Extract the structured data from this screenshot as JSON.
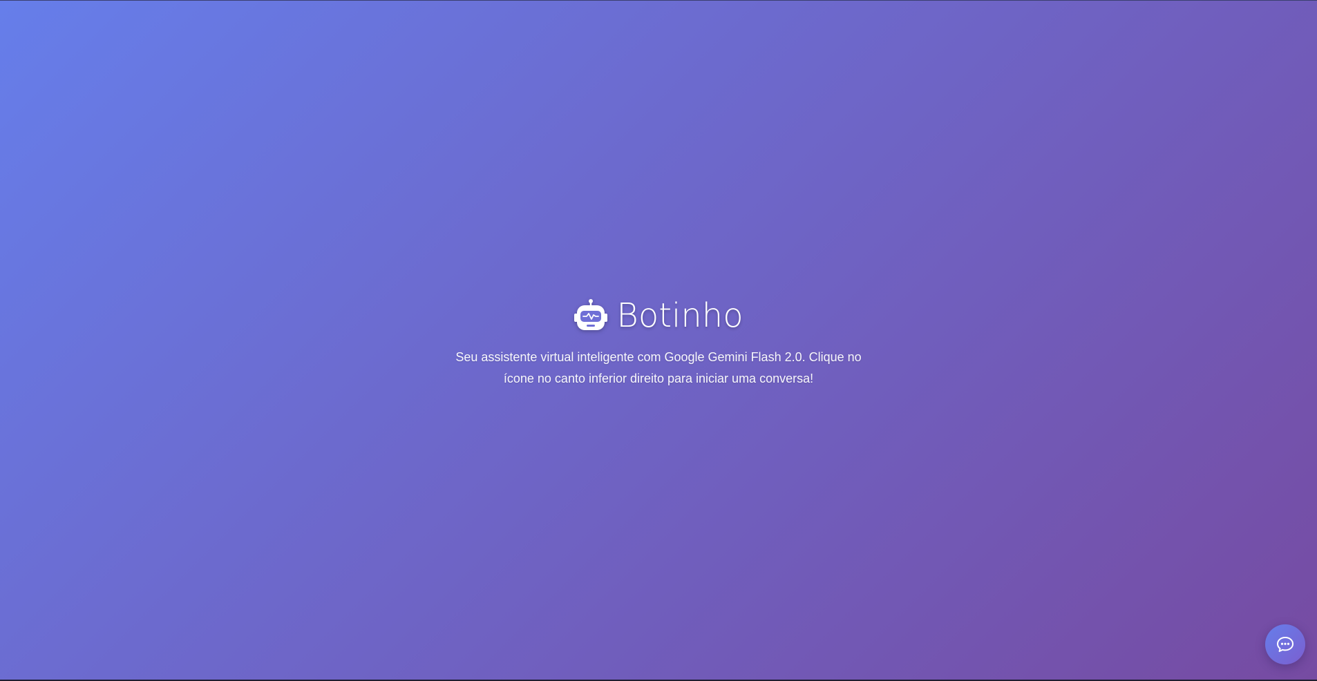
{
  "hero": {
    "title": "Botinho",
    "icon": "robot-icon",
    "subtitle": "Seu assistente virtual inteligente com Google Gemini Flash 2.0. Clique no ícone no canto inferior direito para iniciar uma conversa!"
  },
  "chat_launcher": {
    "icon": "chat-bubble-icon"
  },
  "colors": {
    "gradient_start": "#667eea",
    "gradient_end": "#764ba2",
    "text": "#ffffff"
  }
}
